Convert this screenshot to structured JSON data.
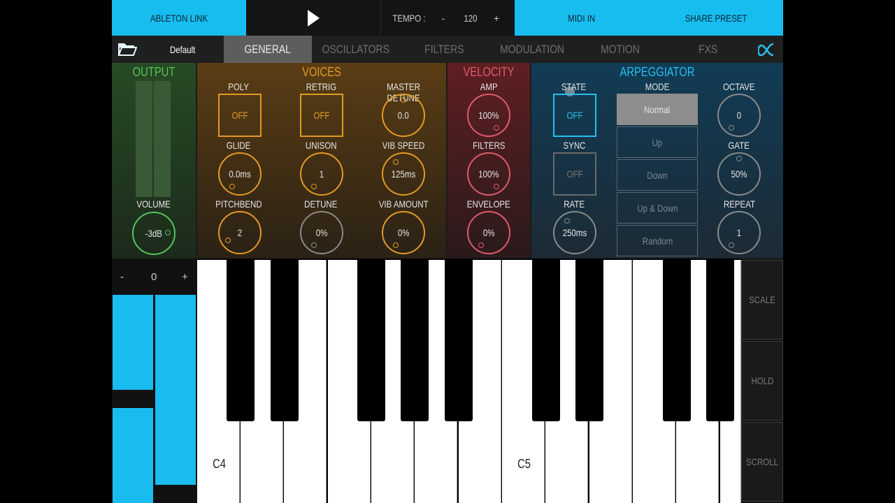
{
  "topbar": {
    "link_label": "ABLETON LINK",
    "tempo_label": "TEMPO :",
    "tempo_minus": "-",
    "tempo_value": "120",
    "tempo_plus": "+",
    "midi_label": "MIDI IN",
    "share_label": "SHARE PRESET"
  },
  "tabbar": {
    "preset_name": "Default",
    "tabs": [
      "GENERAL",
      "OSCILLATORS",
      "FILTERS",
      "MODULATION",
      "MOTION",
      "FXS"
    ],
    "active_tab": "GENERAL"
  },
  "output": {
    "title": "OUTPUT",
    "volume_label": "VOLUME",
    "volume_value": "-3dB"
  },
  "voices": {
    "title": "VOICES",
    "poly_label": "POLY",
    "poly_value": "OFF",
    "retrig_label": "RETRIG",
    "retrig_value": "OFF",
    "master_detune_label": "MASTER DETUNE",
    "master_detune_value": "0.0",
    "glide_label": "GLIDE",
    "glide_value": "0.0ms",
    "unison_label": "UNISON",
    "unison_value": "1",
    "vib_speed_label": "VIB SPEED",
    "vib_speed_value": "125ms",
    "pitchbend_label": "PITCHBEND",
    "pitchbend_value": "2",
    "detune_label": "DETUNE",
    "detune_value": "0%",
    "vib_amount_label": "VIB AMOUNT",
    "vib_amount_value": "0%"
  },
  "velocity": {
    "title": "VELOCITY",
    "amp_label": "AMP",
    "amp_value": "100%",
    "filters_label": "FILTERS",
    "filters_value": "100%",
    "envelope_label": "ENVELOPE",
    "envelope_value": "0%"
  },
  "arpeggiator": {
    "title": "ARPEGGIATOR",
    "state_label": "STATE",
    "state_value": "OFF",
    "sync_label": "SYNC",
    "sync_value": "OFF",
    "rate_label": "RATE",
    "rate_value": "250ms",
    "mode_label": "MODE",
    "modes": [
      "Normal",
      "Up",
      "Down",
      "Up & Down",
      "Random"
    ],
    "selected_mode": "Normal",
    "octave_label": "OCTAVE",
    "octave_value": "0",
    "gate_label": "GATE",
    "gate_value": "50%",
    "repeat_label": "REPEAT",
    "repeat_value": "1"
  },
  "octave_shift": {
    "minus": "-",
    "value": "0",
    "plus": "+"
  },
  "keyboard": {
    "note_labels": [
      "C4",
      "C5"
    ]
  },
  "side_buttons": {
    "scale": "SCALE",
    "hold": "HOLD",
    "scroll": "SCROLL"
  },
  "colors": {
    "accent_cyan": "#18bdf0",
    "voices_orange": "#e29a25",
    "velocity_red": "#e05a6d",
    "output_green": "#56c35b"
  }
}
